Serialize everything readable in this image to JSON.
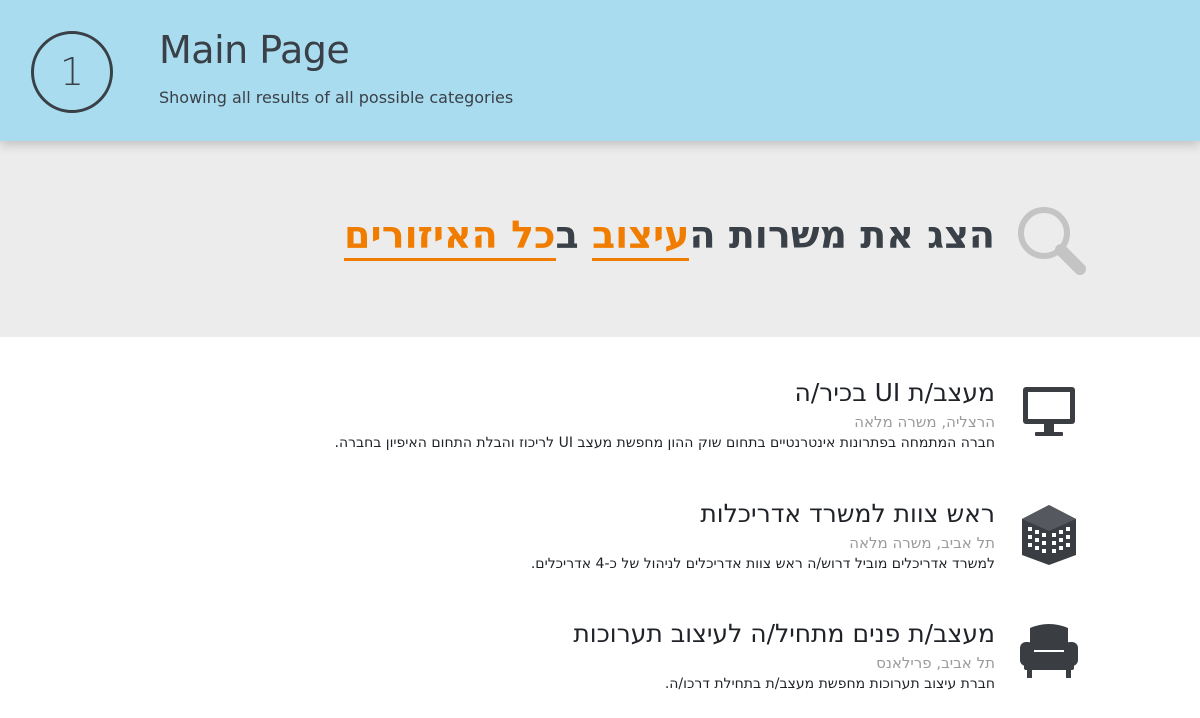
{
  "header": {
    "step": "1",
    "title": "Main Page",
    "subtitle": "Showing all results of all possible categories",
    "background": "#a9dcef"
  },
  "search": {
    "prefix": "הצג את משרות ה",
    "keyword_category": "עיצוב",
    "middle": " ב",
    "keyword_location": "כל האיזורים",
    "accent": "#f07d00",
    "icon": "magnifier-icon"
  },
  "jobs": [
    {
      "title": "מעצב/ת UI בכיר/ה",
      "meta": "הרצליה, משרה מלאה",
      "description": "חברה המתמחה בפתרונות אינטרנטיים בתחום שוק ההון מחפשת מעצב UI לריכוז והבלת התחום האיפיון בחברה.",
      "icon": "monitor-icon"
    },
    {
      "title": "ראש צוות למשרד אדריכלות",
      "meta": "תל אביב, משרה מלאה",
      "description": "למשרד אדריכלים מוביל דרוש/ה ראש צוות אדריכלים לניהול של כ-4 אדריכלים.",
      "icon": "building-icon"
    },
    {
      "title": "מעצב/ת פנים מתחיל/ה לעיצוב תערוכות",
      "meta": "תל אביב, פרילאנס",
      "description": "חברת עיצוב תערוכות מחפשת מעצב/ת בתחילת דרכו/ה.",
      "icon": "armchair-icon"
    }
  ]
}
